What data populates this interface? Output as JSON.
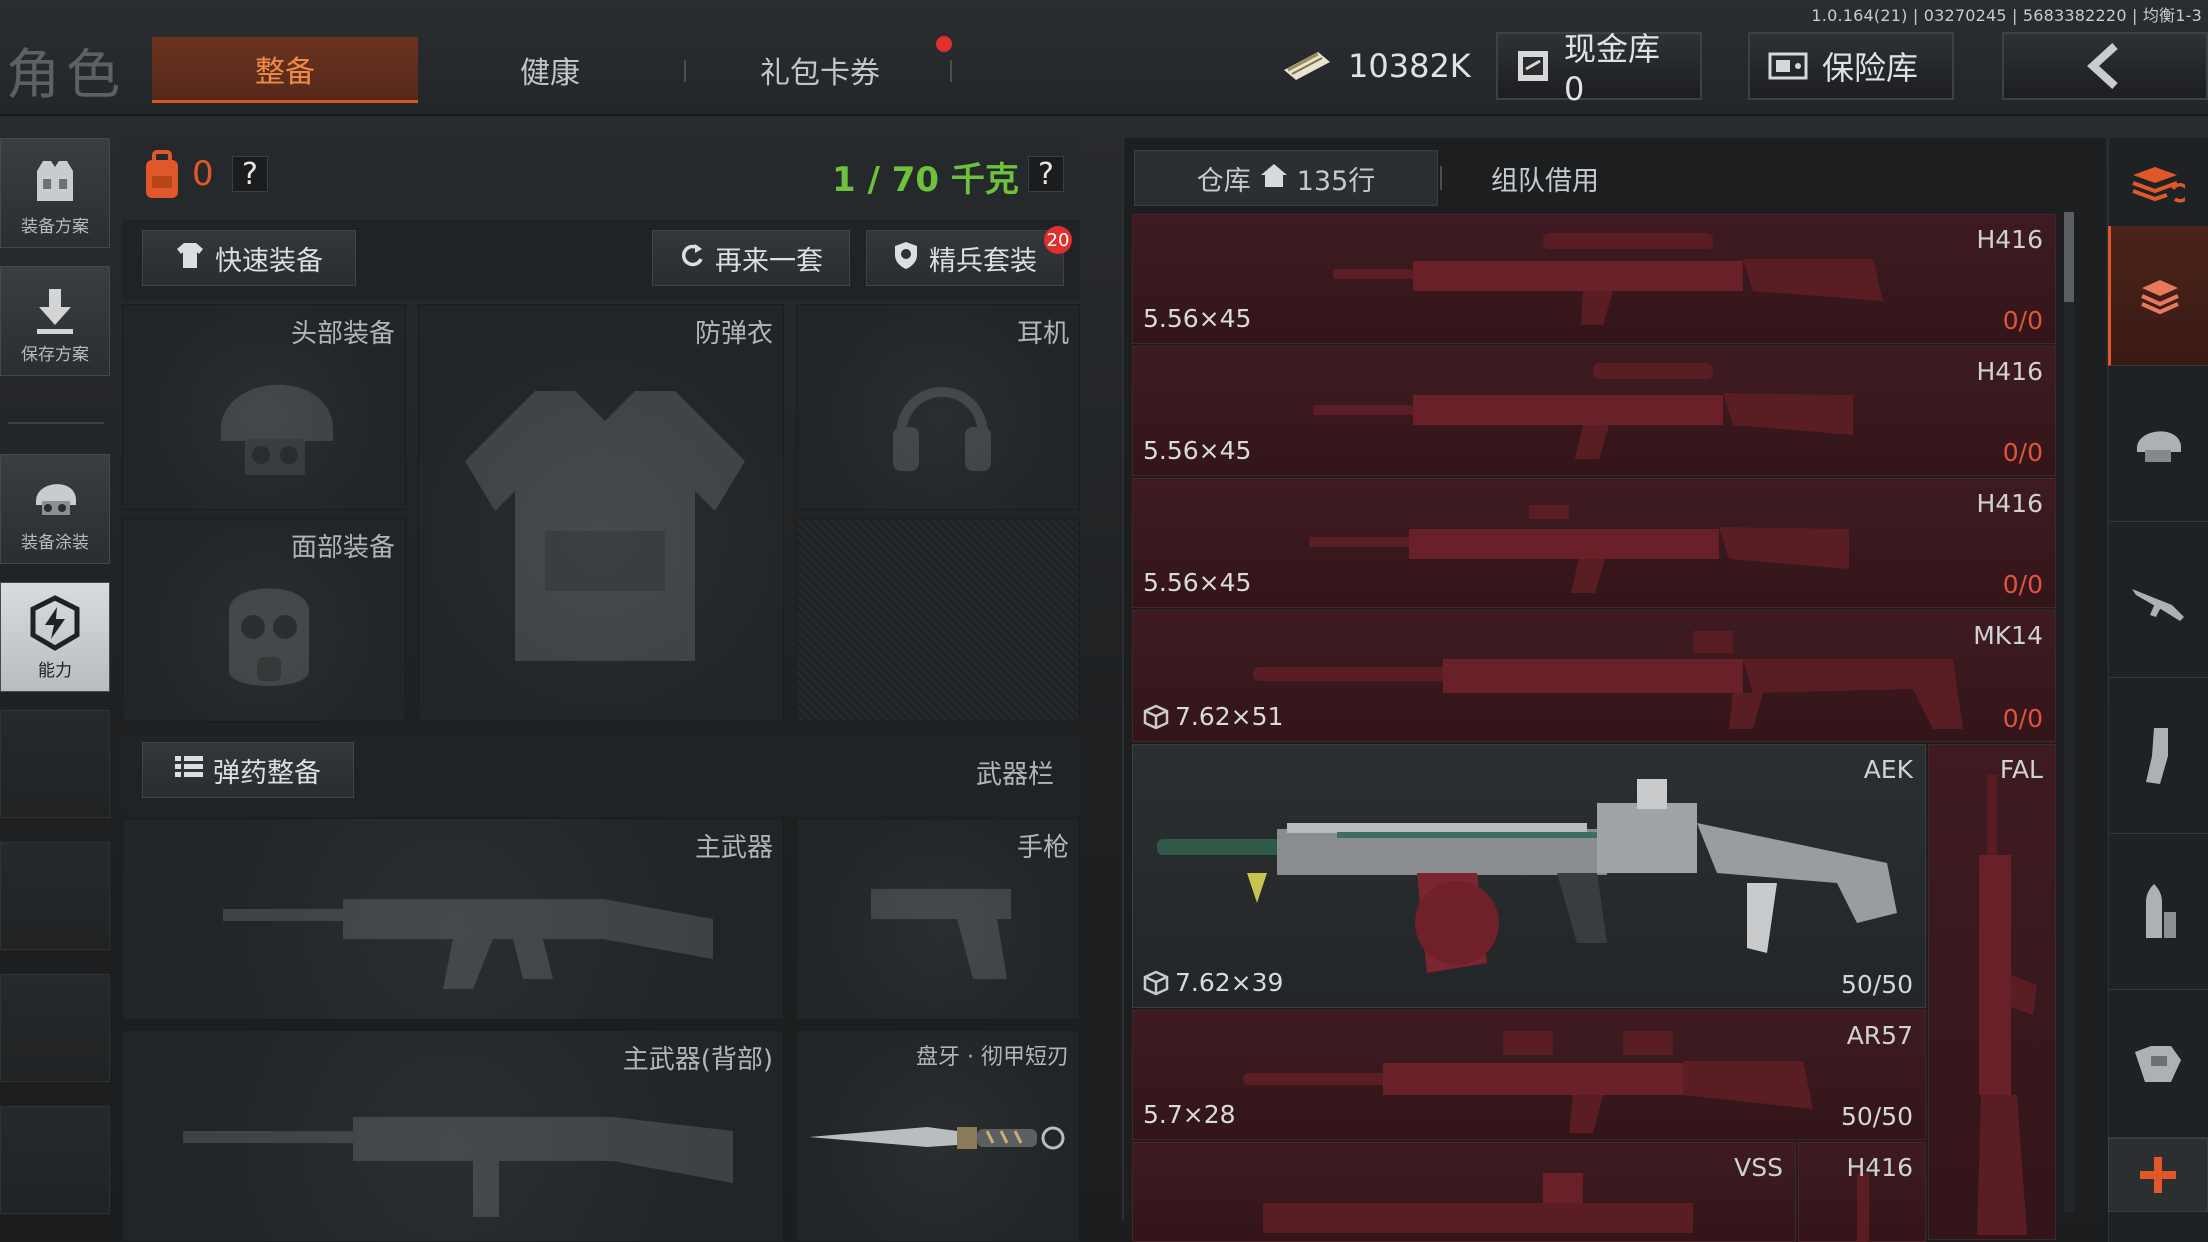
{
  "version": "1.0.164(21) | 03270245 | 5683382220 | 均衡1-3",
  "page_title": "角色",
  "tabs": [
    {
      "label": "整备",
      "active": true
    },
    {
      "label": "健康",
      "active": false
    },
    {
      "label": "礼包卡券",
      "active": false,
      "has_notification": true
    }
  ],
  "currency": {
    "amount": "10382K"
  },
  "cash_vault": {
    "label": "现金库 0"
  },
  "safe_box": {
    "label": "保险库"
  },
  "left_rail": [
    {
      "label": "装备方案",
      "icon": "vest-icon"
    },
    {
      "label": "保存方案",
      "icon": "download-icon"
    },
    {
      "label": "装备涂装",
      "icon": "helmet-icon"
    },
    {
      "label": "能力",
      "icon": "lightning-shield-icon",
      "selected": true
    }
  ],
  "loadout": {
    "armor_value": "0",
    "help_1": "?",
    "weight": "1 / 70 千克",
    "help_2": "?",
    "quick_equip": "快速装备",
    "another_set": "再来一套",
    "elite_kit": "精兵套装",
    "elite_badge": "20",
    "slots": {
      "head": "头部装备",
      "vest": "防弹衣",
      "earphone": "耳机",
      "face": "面部装备"
    },
    "ammo_prep": "弹药整备",
    "weapon_bar": "武器栏",
    "weapon_slots": {
      "primary": "主武器",
      "pistol": "手枪",
      "primary_back": "主武器(背部)",
      "melee": "盘牙 · 彻甲短刃"
    }
  },
  "warehouse": {
    "tab_storage": "仓库",
    "storage_rows": "135行",
    "tab_team": "组队借用",
    "items": [
      {
        "name": "H416",
        "caliber": "5.56×45",
        "durability": "0/0",
        "broken": true
      },
      {
        "name": "H416",
        "caliber": "5.56×45",
        "durability": "0/0",
        "broken": true
      },
      {
        "name": "H416",
        "caliber": "5.56×45",
        "durability": "0/0",
        "broken": true
      },
      {
        "name": "MK14",
        "caliber": "7.62×51",
        "durability": "0/0",
        "broken": true,
        "has_box_icon": true
      },
      {
        "name": "AEK",
        "caliber": "7.62×39",
        "durability": "50/50",
        "broken": false,
        "has_box_icon": true
      },
      {
        "name": "FAL",
        "caliber": "",
        "durability": "",
        "broken": false
      },
      {
        "name": "AR57",
        "caliber": "5.7×28",
        "durability": "50/50",
        "broken": false
      },
      {
        "name": "VSS",
        "caliber": "",
        "durability": "",
        "broken": false
      },
      {
        "name": "H416",
        "caliber": "",
        "durability": "",
        "broken": false
      }
    ]
  },
  "right_categories": [
    "stack-sort-icon",
    "all-items-icon",
    "helmet-icon",
    "rifle-icon",
    "magazine-icon",
    "ammo-icon",
    "armor-icon",
    "add-icon"
  ],
  "colors": {
    "accent": "#e0582a",
    "durability_broken": "#e1523f",
    "weight_green": "#6cc23a",
    "card_red": "#3a1a20"
  }
}
